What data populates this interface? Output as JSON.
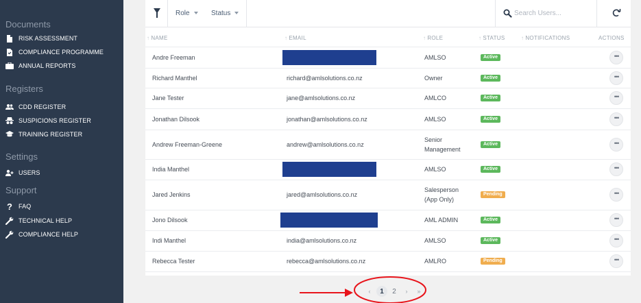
{
  "sidebar": {
    "sections": [
      {
        "title": "Documents",
        "items": [
          {
            "label": "RISK ASSESSMENT",
            "icon": "document-icon"
          },
          {
            "label": "COMPLIANCE PROGRAMME",
            "icon": "document-check-icon"
          },
          {
            "label": "ANNUAL REPORTS",
            "icon": "briefcase-icon"
          }
        ]
      },
      {
        "title": "Registers",
        "items": [
          {
            "label": "CDD REGISTER",
            "icon": "people-icon"
          },
          {
            "label": "SUSPICIONS REGISTER",
            "icon": "incognito-icon"
          },
          {
            "label": "TRAINING REGISTER",
            "icon": "graduation-cap-icon"
          }
        ]
      },
      {
        "title": "Settings",
        "items": [
          {
            "label": "USERS",
            "icon": "user-add-icon"
          }
        ]
      },
      {
        "title": "Support",
        "items": [
          {
            "label": "FAQ",
            "icon": "question-icon"
          },
          {
            "label": "TECHNICAL HELP",
            "icon": "wrench-icon"
          },
          {
            "label": "COMPLIANCE HELP",
            "icon": "wrench-icon"
          }
        ]
      }
    ]
  },
  "toolbar": {
    "role_filter": "Role",
    "status_filter": "Status",
    "search_placeholder": "Search Users..."
  },
  "table": {
    "headers": {
      "name": "NAME",
      "email": "EMAIL",
      "role": "ROLE",
      "status": "STATUS",
      "notifications": "NOTIFICATIONS",
      "actions": "ACTIONS"
    },
    "rows": [
      {
        "name": "Andre Freeman",
        "email": "",
        "email_redacted": true,
        "role": [
          "AMLSO"
        ],
        "status": "Active"
      },
      {
        "name": "Richard Manthel",
        "email": "richard@amlsolutions.co.nz",
        "email_redacted": false,
        "role": [
          "Owner"
        ],
        "status": "Active"
      },
      {
        "name": "Jane Tester",
        "email": "jane@amlsolutions.co.nz",
        "email_redacted": false,
        "role": [
          "AMLCO"
        ],
        "status": "Active"
      },
      {
        "name": "Jonathan Dilsook",
        "email": "jonathan@amlsolutions.co.nz",
        "email_redacted": false,
        "role": [
          "AMLSO"
        ],
        "status": "Active"
      },
      {
        "name": "Andrew Freeman-Greene",
        "email": "andrew@amlsolutions.co.nz",
        "email_redacted": false,
        "role": [
          "Senior",
          "Management"
        ],
        "status": "Active"
      },
      {
        "name": "India Manthel",
        "email": "",
        "email_redacted": true,
        "role": [
          "AMLSO"
        ],
        "status": "Active"
      },
      {
        "name": "Jared Jenkins",
        "email": "jared@amlsolutions.co.nz",
        "email_redacted": false,
        "role": [
          "Salesperson",
          "(App Only)"
        ],
        "status": "Pending"
      },
      {
        "name": "Jono Dilsook",
        "email": "",
        "email_redacted": true,
        "role": [
          "AML ADMIN"
        ],
        "status": "Active"
      },
      {
        "name": "Indi Manthel",
        "email": "india@amlsolutions.co.nz",
        "email_redacted": false,
        "role": [
          "AMLSO"
        ],
        "status": "Active"
      },
      {
        "name": "Rebecca Tester",
        "email": "rebecca@amlsolutions.co.nz",
        "email_redacted": false,
        "role": [
          "AMLRO"
        ],
        "status": "Pending"
      }
    ],
    "action_label": "•••"
  },
  "pagination": {
    "first": "«",
    "prev": "‹",
    "pages": [
      "1",
      "2"
    ],
    "current": "1",
    "next": "›",
    "last": "»"
  },
  "colors": {
    "sidebar_bg": "#2c3a4d",
    "active_badge": "#5cb85c",
    "pending_badge": "#f0ad4e",
    "redaction": "#1f3f8f",
    "annotation": "#e8141b"
  }
}
